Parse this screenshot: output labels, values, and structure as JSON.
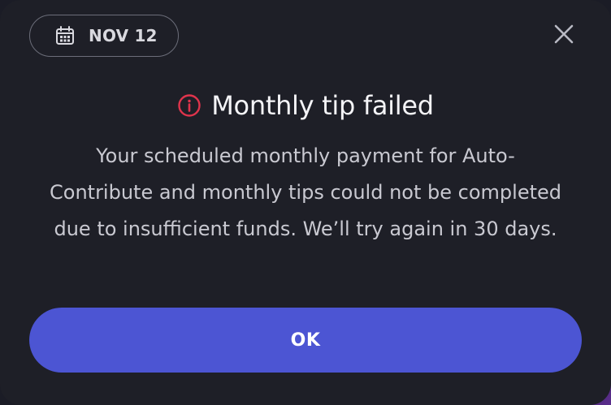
{
  "dialog": {
    "date": "NOV 12",
    "title": "Monthly tip failed",
    "message": "Your scheduled monthly payment for Auto-Contribute and monthly tips could not be completed due to insufficient funds. We’ll try again in 30 days.",
    "ok_label": "OK"
  },
  "icons": {
    "calendar": "calendar-icon",
    "close": "close-icon",
    "info": "info-icon"
  },
  "colors": {
    "background": "#1e1f27",
    "accent": "#4c55d3",
    "error": "#e0344c",
    "text_primary": "#f4f4f7",
    "text_secondary": "#c9c9d1"
  }
}
